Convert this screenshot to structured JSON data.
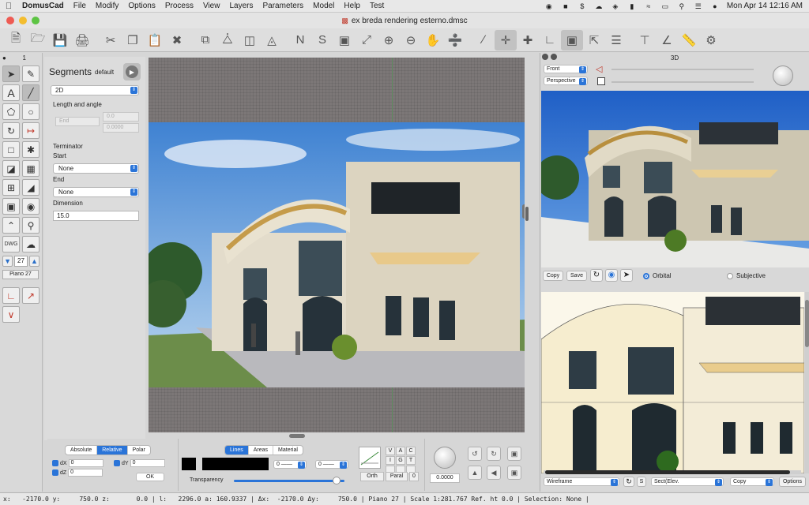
{
  "menubar": {
    "app": "DomusCad",
    "items": [
      "File",
      "Modify",
      "Options",
      "Process",
      "View",
      "Layers",
      "Parameters",
      "Model",
      "Help",
      "Test"
    ],
    "datetime": "Mon Apr 14  12:16 AM"
  },
  "window": {
    "title": "ex breda rendering esterno.dmsc"
  },
  "palette": {
    "header": "1",
    "piano_number": "27",
    "piano_label": "Piano 27"
  },
  "segments": {
    "title": "Segments",
    "subtitle": "default",
    "mode": "2D",
    "length_angle_label": "Length and angle",
    "end_select": "End",
    "value_a": "0.0",
    "value_b": "0.0000",
    "terminator_label": "Terminator",
    "start_label": "Start",
    "start_value": "None",
    "end_label": "End",
    "end_value": "None",
    "dimension_label": "Dimension",
    "dimension_value": "15.0"
  },
  "coords": {
    "modes": [
      "Absolute",
      "Relative",
      "Polar"
    ],
    "active_mode": "Relative",
    "dx_label": "dX",
    "dx_value": "0",
    "dy_label": "dY",
    "dy_value": "0",
    "dz_label": "dZ",
    "dz_value": "0",
    "ok_label": "OK"
  },
  "style": {
    "tabs": [
      "Lines",
      "Areas",
      "Material"
    ],
    "active_tab": "Lines",
    "select_1": "0",
    "select_2": "0",
    "transparency_label": "Transparency",
    "transparency": 0.93
  },
  "snap": {
    "grid_letters": [
      "V",
      "A",
      "C",
      "I",
      "G",
      "T",
      "",
      "",
      ""
    ],
    "orth_label": "Orth",
    "paral_label": "Paral",
    "zero_label": "0",
    "angle_value": "0.0000"
  },
  "view3d": {
    "panel_title": "3D",
    "view_select": "Front",
    "projection_select": "Perspective",
    "copy_label": "Copy",
    "save_label": "Save",
    "orbital_label": "Orbital",
    "subjective_label": "Subjective",
    "active_nav": "Orbital"
  },
  "wireframe_bar": {
    "mode": "Wireframe",
    "s_label": "S",
    "section": "Sect(Elev.",
    "copy_select": "Copy",
    "options_label": "Options"
  },
  "statusbar": {
    "text": "x:   -2170.0 y:     750.0 z:       0.0 | l:   2296.0 a: 160.9337 | Δx:  -2170.0 Δy:     750.0 | Piano 27 | Scale 1:281.767 Ref. ht 0.0 | Selection: None |"
  },
  "colors": {
    "accent": "#2a74d8",
    "canvas_bg": "#7c7777",
    "sky": "#4d8fd6"
  }
}
